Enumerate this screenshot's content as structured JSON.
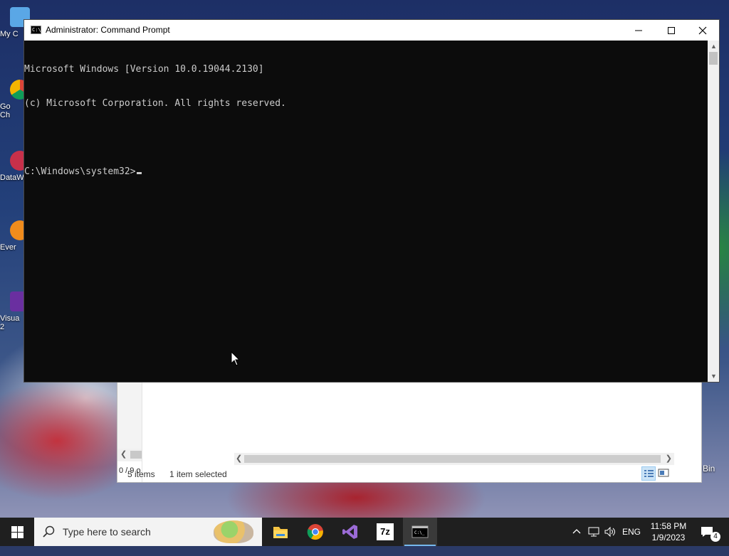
{
  "desktop": {
    "icons": [
      {
        "label": "My C",
        "icon": "computer-icon"
      },
      {
        "label": "Go\nCh",
        "icon": "chrome-icon"
      },
      {
        "label": "DataW",
        "icon": "datawrangler-icon"
      },
      {
        "label": "Ever",
        "icon": "everything-icon"
      },
      {
        "label": "Visua\n2",
        "icon": "visual-studio-icon"
      }
    ],
    "recycle_bin_label": "Bin"
  },
  "explorer": {
    "status_items": "5 items",
    "status_selected": "1 item selected",
    "nav_status": "0 / 9 o"
  },
  "cmd": {
    "title": "Administrator: Command Prompt",
    "icon_text": "C:\\",
    "lines": [
      "Microsoft Windows [Version 10.0.19044.2130]",
      "(c) Microsoft Corporation. All rights reserved.",
      "",
      "C:\\Windows\\system32>"
    ],
    "colors": {
      "background": "#0c0c0c",
      "text": "#cccccc"
    }
  },
  "taskbar": {
    "search_placeholder": "Type here to search",
    "apps": [
      {
        "name": "file-explorer",
        "icon": "folder-icon"
      },
      {
        "name": "google-chrome",
        "icon": "chrome-icon"
      },
      {
        "name": "visual-studio",
        "icon": "visual-studio-icon"
      },
      {
        "name": "7-zip",
        "icon": "7zip-icon",
        "label": "7z"
      },
      {
        "name": "command-prompt",
        "icon": "cmd-icon",
        "active": true
      }
    ],
    "language": "ENG",
    "time": "11:58 PM",
    "date": "1/9/2023",
    "notification_count": "4"
  }
}
